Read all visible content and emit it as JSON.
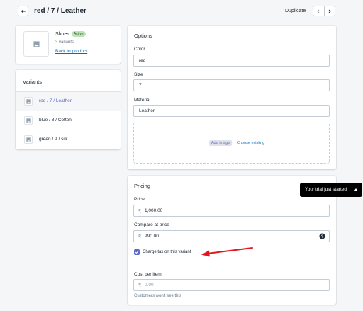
{
  "header": {
    "title": "red / 7 / Leather",
    "duplicate_label": "Duplicate"
  },
  "product": {
    "name": "Shoes",
    "status": "Active",
    "variant_count": "3 variants",
    "back_link": "Back to product"
  },
  "variants": {
    "title": "Variants",
    "items": [
      {
        "label": "red / 7 / Leather",
        "selected": true
      },
      {
        "label": "blue / 8 / Cotton",
        "selected": false
      },
      {
        "label": "green / 9 / silk",
        "selected": false
      }
    ]
  },
  "options": {
    "title": "Options",
    "color_label": "Color",
    "color_value": "red",
    "size_label": "Size",
    "size_value": "7",
    "material_label": "Material",
    "material_value": "Leather",
    "add_image": "Add image",
    "choose_existing": "Choose existing"
  },
  "pricing": {
    "title": "Pricing",
    "price_label": "Price",
    "price_value": "1,000.00",
    "compare_label": "Compare at price",
    "compare_value": "990.00",
    "currency_symbol": "₹",
    "charge_tax_label": "Charge tax on this variant",
    "charge_tax_checked": true,
    "cost_label": "Cost per item",
    "cost_placeholder": "0.00",
    "cost_hint": "Customers won't see this"
  },
  "trial_popup": {
    "text": "Your trial just started"
  },
  "colors": {
    "accent": "#5c6ac4",
    "link": "#006fbb",
    "badge_bg": "#bbe5b3",
    "annotation_arrow": "#e0171f"
  },
  "icons": {
    "back": "arrow-left-icon",
    "prev": "chevron-left-icon",
    "next": "chevron-right-icon",
    "image": "image-placeholder-icon",
    "help": "question-circle-icon",
    "check": "checkmark-icon",
    "caret": "caret-up-icon"
  }
}
